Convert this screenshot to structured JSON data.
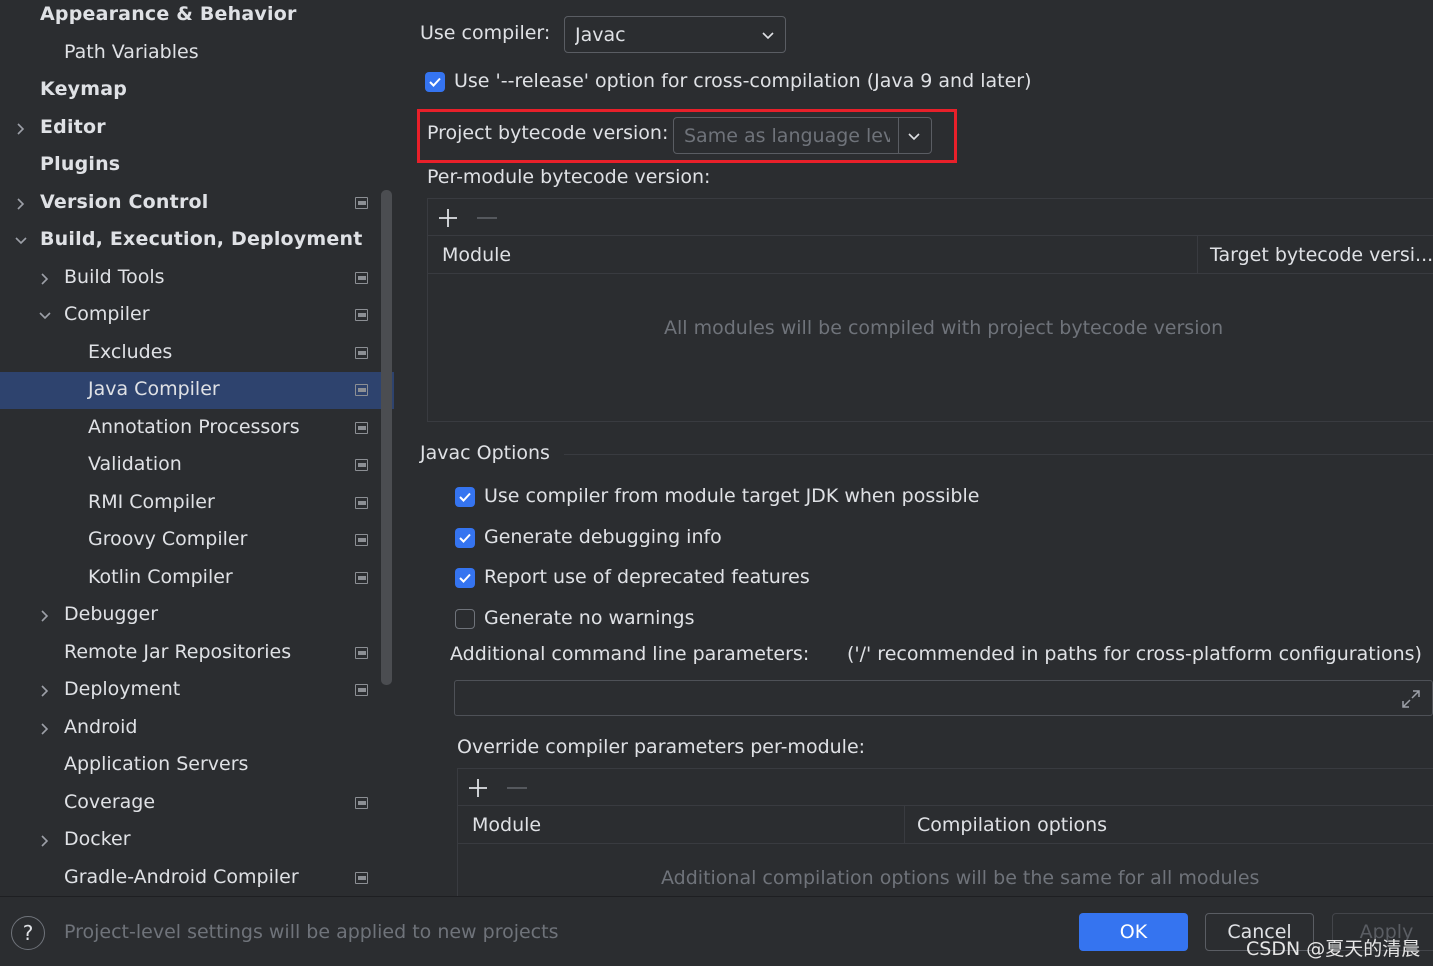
{
  "sidebar": {
    "items": [
      {
        "label": "Appearance & Behavior",
        "bold": true,
        "level": 0,
        "chevron": "none",
        "project_icon": false,
        "selected": false
      },
      {
        "label": "Path Variables",
        "bold": false,
        "level": 1,
        "chevron": "none",
        "project_icon": false,
        "selected": false
      },
      {
        "label": "Keymap",
        "bold": true,
        "level": 0,
        "chevron": "none",
        "project_icon": false,
        "selected": false
      },
      {
        "label": "Editor",
        "bold": true,
        "level": 0,
        "chevron": "right",
        "project_icon": false,
        "selected": false
      },
      {
        "label": "Plugins",
        "bold": true,
        "level": 0,
        "chevron": "none",
        "project_icon": false,
        "selected": false
      },
      {
        "label": "Version Control",
        "bold": true,
        "level": 0,
        "chevron": "right",
        "project_icon": true,
        "selected": false
      },
      {
        "label": "Build, Execution, Deployment",
        "bold": true,
        "level": 0,
        "chevron": "down",
        "project_icon": false,
        "selected": false
      },
      {
        "label": "Build Tools",
        "bold": false,
        "level": 1,
        "chevron": "right",
        "project_icon": true,
        "selected": false
      },
      {
        "label": "Compiler",
        "bold": false,
        "level": 1,
        "chevron": "down",
        "project_icon": true,
        "selected": false
      },
      {
        "label": "Excludes",
        "bold": false,
        "level": 2,
        "chevron": "none",
        "project_icon": true,
        "selected": false
      },
      {
        "label": "Java Compiler",
        "bold": false,
        "level": 2,
        "chevron": "none",
        "project_icon": true,
        "selected": true
      },
      {
        "label": "Annotation Processors",
        "bold": false,
        "level": 2,
        "chevron": "none",
        "project_icon": true,
        "selected": false
      },
      {
        "label": "Validation",
        "bold": false,
        "level": 2,
        "chevron": "none",
        "project_icon": true,
        "selected": false
      },
      {
        "label": "RMI Compiler",
        "bold": false,
        "level": 2,
        "chevron": "none",
        "project_icon": true,
        "selected": false
      },
      {
        "label": "Groovy Compiler",
        "bold": false,
        "level": 2,
        "chevron": "none",
        "project_icon": true,
        "selected": false
      },
      {
        "label": "Kotlin Compiler",
        "bold": false,
        "level": 2,
        "chevron": "none",
        "project_icon": true,
        "selected": false
      },
      {
        "label": "Debugger",
        "bold": false,
        "level": 1,
        "chevron": "right",
        "project_icon": false,
        "selected": false
      },
      {
        "label": "Remote Jar Repositories",
        "bold": false,
        "level": 1,
        "chevron": "none",
        "project_icon": true,
        "selected": false
      },
      {
        "label": "Deployment",
        "bold": false,
        "level": 1,
        "chevron": "right",
        "project_icon": true,
        "selected": false
      },
      {
        "label": "Android",
        "bold": false,
        "level": 1,
        "chevron": "right",
        "project_icon": false,
        "selected": false
      },
      {
        "label": "Application Servers",
        "bold": false,
        "level": 1,
        "chevron": "none",
        "project_icon": false,
        "selected": false
      },
      {
        "label": "Coverage",
        "bold": false,
        "level": 1,
        "chevron": "none",
        "project_icon": true,
        "selected": false
      },
      {
        "label": "Docker",
        "bold": false,
        "level": 1,
        "chevron": "right",
        "project_icon": false,
        "selected": false
      },
      {
        "label": "Gradle-Android Compiler",
        "bold": false,
        "level": 1,
        "chevron": "none",
        "project_icon": true,
        "selected": false
      }
    ]
  },
  "main": {
    "use_compiler_label": "Use compiler:",
    "use_compiler_value": "Javac",
    "release_option_label": "Use '--release' option for cross-compilation (Java 9 and later)",
    "release_option_checked": true,
    "bytecode_version_label": "Project bytecode version:",
    "bytecode_version_placeholder": "Same as language level",
    "per_module_label": "Per-module bytecode version:",
    "per_module_table": {
      "columns": [
        "Module",
        "Target bytecode versi..."
      ],
      "empty_text": "All modules will be compiled with project bytecode version"
    },
    "javac_options_title": "Javac Options",
    "javac_options": [
      {
        "label": "Use compiler from module target JDK when possible",
        "checked": true
      },
      {
        "label": "Generate debugging info",
        "checked": true
      },
      {
        "label": "Report use of deprecated features",
        "checked": true
      },
      {
        "label": "Generate no warnings",
        "checked": false
      }
    ],
    "additional_params_label": "Additional command line parameters:",
    "additional_params_hint": "('/' recommended in paths for cross-platform configurations)",
    "additional_params_value": "",
    "override_label": "Override compiler parameters per-module:",
    "override_table": {
      "columns": [
        "Module",
        "Compilation options"
      ],
      "empty_text": "Additional compilation options will be the same for all modules"
    }
  },
  "bottom": {
    "help_label": "?",
    "status_text": "Project-level settings will be applied to new projects",
    "ok_label": "OK",
    "cancel_label": "Cancel",
    "apply_label": "Apply"
  },
  "watermark": "CSDN @夏天的清晨",
  "colors": {
    "accent": "#3574f0",
    "selection": "#2e436e",
    "highlight_box": "#e8202a",
    "background": "#2b2d30"
  }
}
